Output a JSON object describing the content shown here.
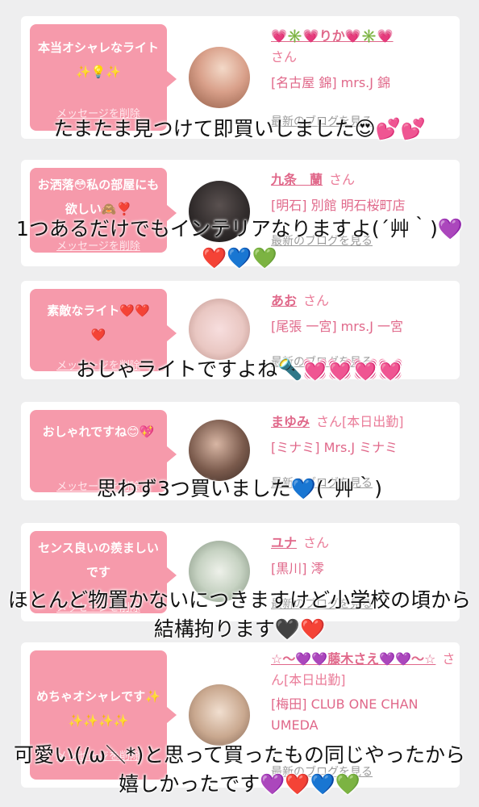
{
  "cards": [
    {
      "bubble_text": "本当オシャレなライト✨💡✨",
      "delete_label": "メッセージを削除",
      "name": "💗✳️💗りか💗✳️💗",
      "name_suffix": "さん",
      "shop": "[名古屋 錦] mrs.J 錦",
      "blog_label": "最新のブログを見る",
      "avatar_color": "#d9a08a"
    },
    {
      "bubble_text": "お洒落😳私の部屋にも欲しい🙈❣️",
      "delete_label": "メッセージを削除",
      "name": "九条　蘭",
      "name_suffix": "さん",
      "shop": "[明石] 別館 明石桜町店",
      "blog_label": "最新のブログを見る",
      "avatar_color": "#3a3433"
    },
    {
      "bubble_text": "素敵なライト❤️❤️❤️",
      "delete_label": "メッセージを削除",
      "name": "あお",
      "name_suffix": "さん",
      "shop": "[尾張 一宮] mrs.J 一宮",
      "blog_label": "最新のブログを見る",
      "avatar_color": "#e9c7c2"
    },
    {
      "bubble_text": "おしゃれですね😊💖",
      "delete_label": "メッセージを削除",
      "name": "まゆみ",
      "name_suffix": "さん[本日出勤]",
      "shop": "[ミナミ] Mrs.J ミナミ",
      "blog_label": "最新のブログを見る",
      "avatar_color": "#7a5a4c"
    },
    {
      "bubble_text": "センス良いの羨ましいです",
      "delete_label": "メッセージを削除",
      "name": "ユナ",
      "name_suffix": "さん",
      "shop": "[黒川] 澪",
      "blog_label": "最新のブログを見る",
      "avatar_color": "#c6d2c2"
    },
    {
      "bubble_text": "めちゃオシャレです✨✨✨✨✨",
      "delete_label": "メッセージを削除",
      "name": "☆〜💜💜藤木さえ💜💜〜☆",
      "name_suffix": "さん[本日出勤]",
      "shop": "[梅田] CLUB ONE CHAN UMEDA",
      "blog_label": "最新のブログを見る",
      "avatar_color": "#c9a88f"
    }
  ],
  "comments": [
    "たまたま見つけて即買いしました😍💕💕",
    "1つあるだけでもインテリアなりますよ(´艸｀)💜❤️💙💚",
    "おしゃライトですよね🔦💓💓💓💓",
    "思わず3つ買いました💙(´艸｀)",
    "ほとんど物置かないにつきますけど小学校の頃から結構拘ります🖤❤️",
    "可愛い(/ω＼*)と思って買ったもの同じやったから嬉しかったです💜❤️💙💚"
  ],
  "colors": {
    "page_bg": "#eeeeef",
    "bubble": "#f69aab",
    "accent": "#e0688a"
  }
}
